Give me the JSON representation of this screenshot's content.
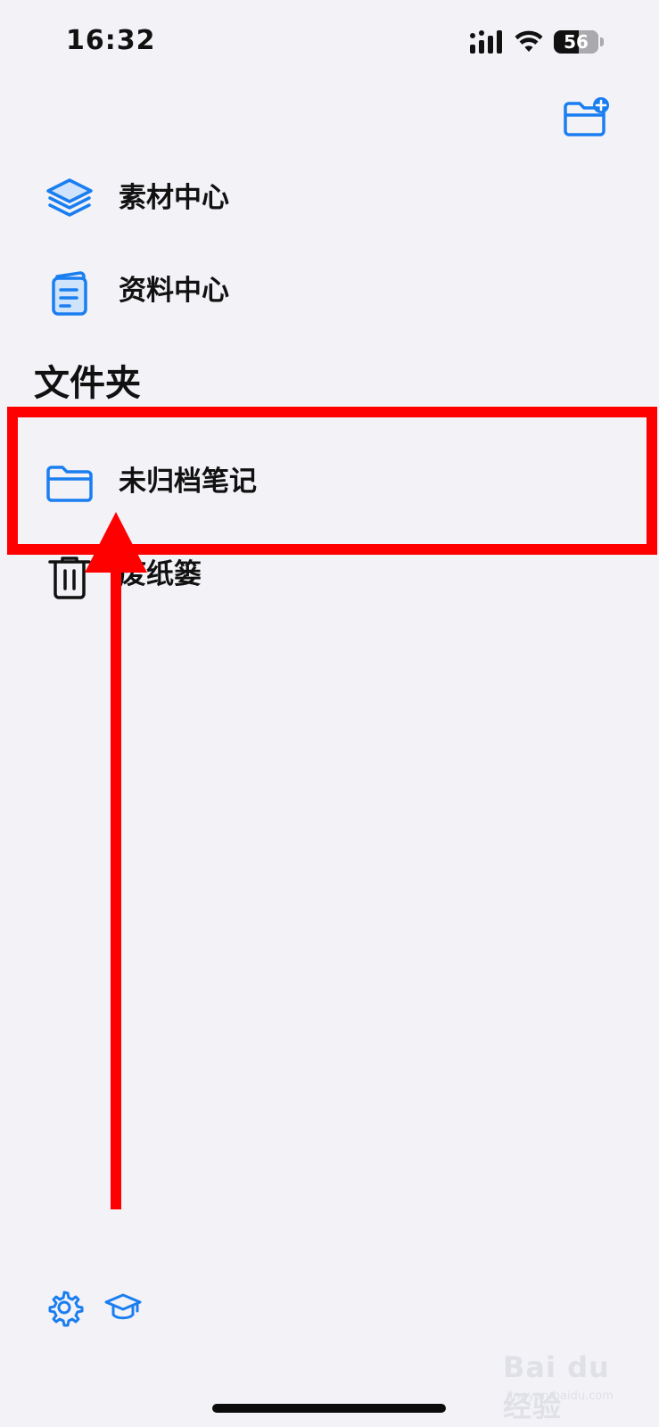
{
  "status_bar": {
    "time": "16:32",
    "battery": "56",
    "icons": [
      "signal-icon",
      "wifi-icon",
      "battery-icon"
    ]
  },
  "top_actions": {
    "new_folder_icon": "folder-plus-icon"
  },
  "menu": {
    "items": [
      {
        "label": "素材中心",
        "icon": "layers-icon"
      },
      {
        "label": "资料中心",
        "icon": "document-icon"
      }
    ]
  },
  "folders": {
    "title": "文件夹",
    "items": [
      {
        "label": "未归档笔记",
        "icon": "folder-icon"
      },
      {
        "label": "废纸篓",
        "icon": "trash-icon"
      }
    ]
  },
  "bottom_bar": {
    "icons": [
      "gear-icon",
      "graduation-cap-icon"
    ]
  },
  "annotation": {
    "color": "#ff0000"
  },
  "theme": {
    "accent": "#1a7ef0",
    "background": "#f2f2f7"
  },
  "watermark": {
    "text": "Bai du 经验",
    "sub": "jingyan.baidu.com"
  }
}
